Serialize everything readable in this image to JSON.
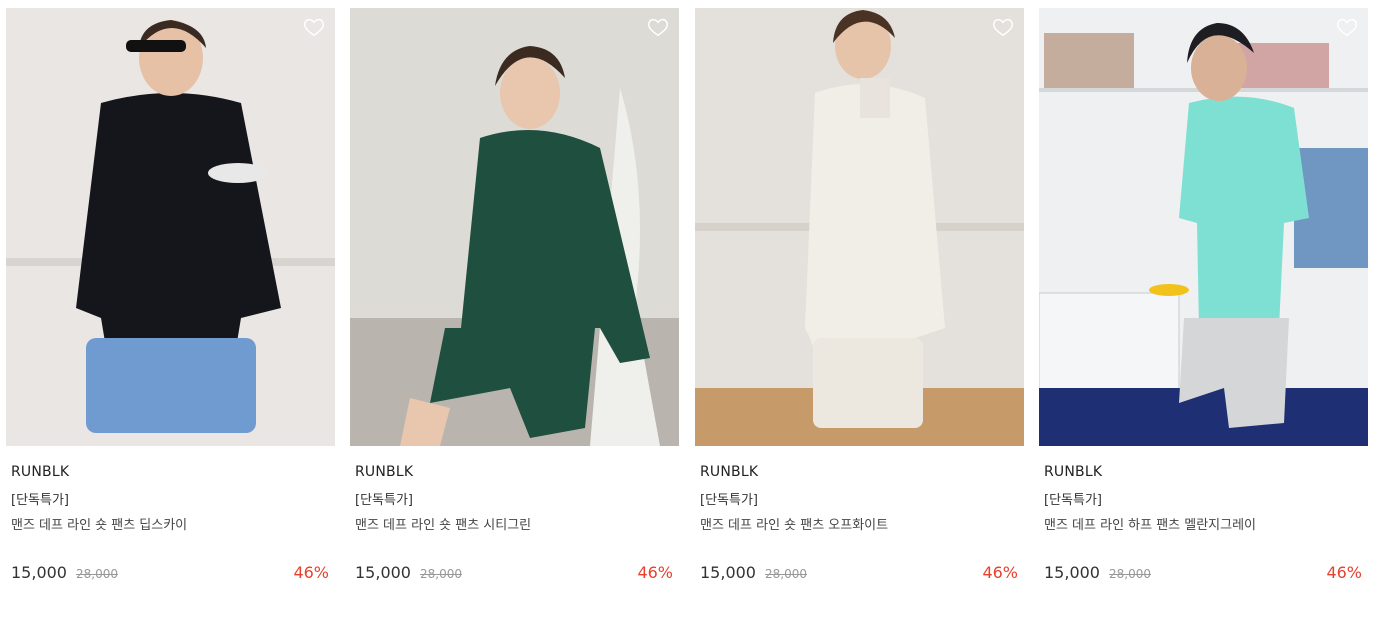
{
  "products": [
    {
      "brand": "RUNBLK",
      "tag": "[단독특가]",
      "name": "맨즈 데프 라인 숏 팬츠 딥스카이",
      "price": "15,000",
      "original_price": "28,000",
      "discount": "46%",
      "colors": {
        "bg": "#e9e6e3",
        "top": "#15161b",
        "bottom": "#6f9bd0",
        "skin": "#e6c1a6",
        "hair": "#3b2a22"
      }
    },
    {
      "brand": "RUNBLK",
      "tag": "[단독특가]",
      "name": "맨즈 데프 라인 숏 팬츠 시티그린",
      "price": "15,000",
      "original_price": "28,000",
      "discount": "46%",
      "colors": {
        "bg": "#dcdbd6",
        "top": "#1f4f3f",
        "bottom": "#1f4f3f",
        "skin": "#e8c7ae",
        "hair": "#3a2a20"
      }
    },
    {
      "brand": "RUNBLK",
      "tag": "[단독특가]",
      "name": "맨즈 데프 라인 숏 팬츠 오프화이트",
      "price": "15,000",
      "original_price": "28,000",
      "discount": "46%",
      "colors": {
        "bg": "#e4e0db",
        "top": "#f1eee8",
        "bottom": "#ece8e0",
        "skin": "#e6c4aa",
        "hair": "#4a3324"
      }
    },
    {
      "brand": "RUNBLK",
      "tag": "[단독특가]",
      "name": "맨즈 데프 라인 하프 팬츠 멜란지그레이",
      "price": "15,000",
      "original_price": "28,000",
      "discount": "46%",
      "colors": {
        "bg": "#eef0f1",
        "top": "#7ee0d2",
        "bottom": "#d4d6d8",
        "skin": "#d9b196",
        "hair": "#1d1d22"
      }
    }
  ]
}
